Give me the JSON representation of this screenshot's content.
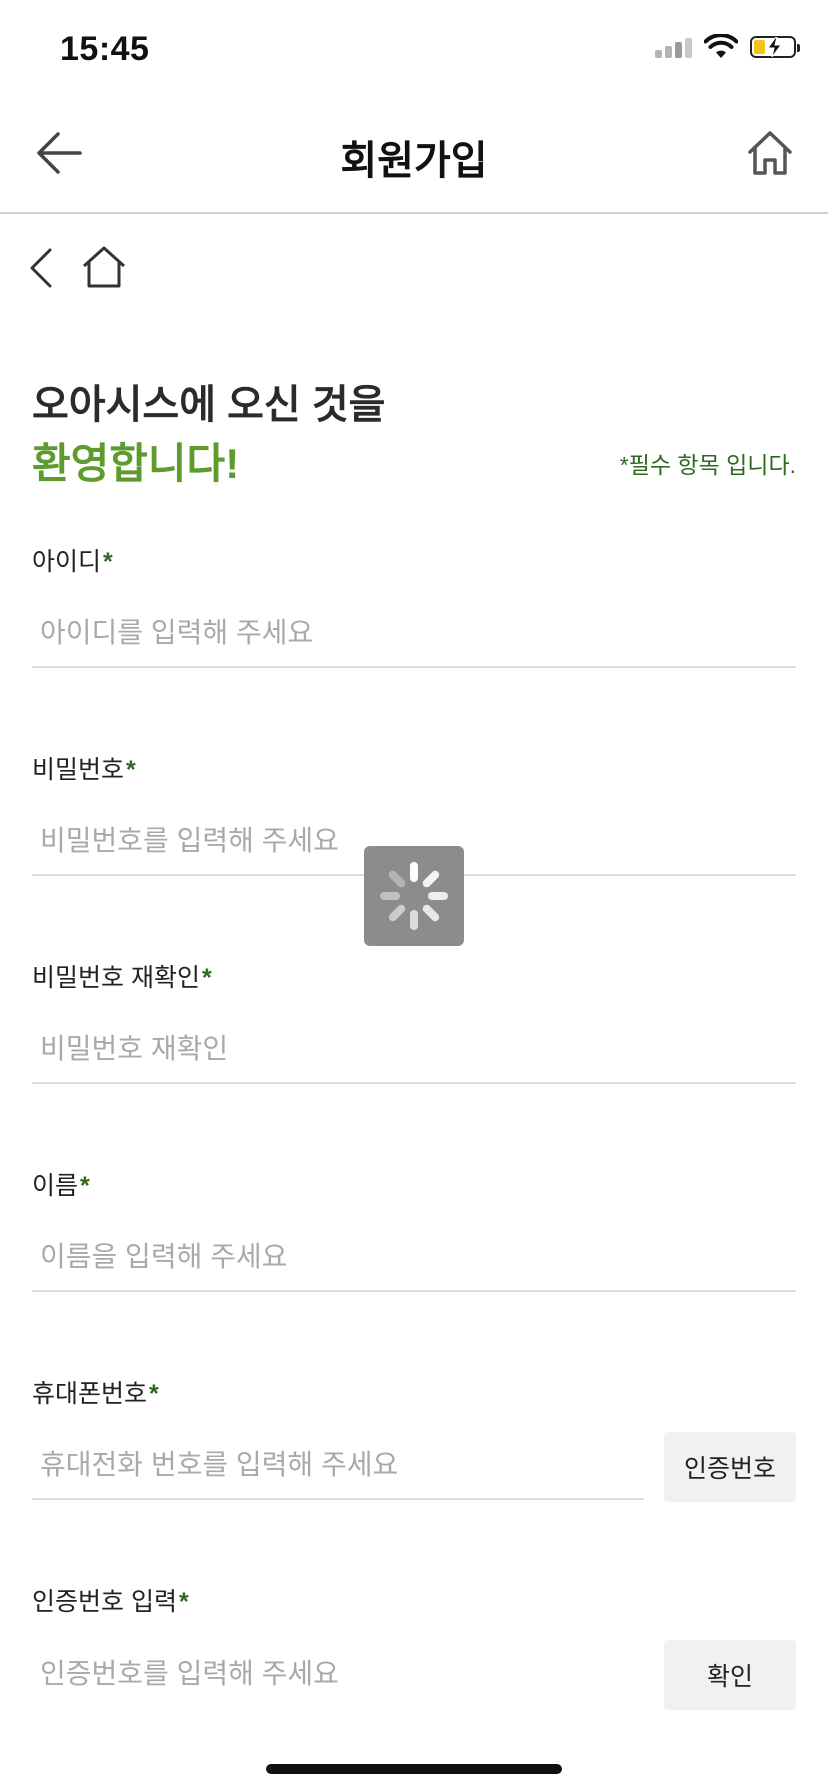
{
  "status_bar": {
    "time": "15:45",
    "icons": [
      "cellular-signal-icon",
      "wifi-icon",
      "battery-charging-icon"
    ],
    "battery_fill_fraction": 0.3,
    "battery_color": "#f2c318"
  },
  "header": {
    "title": "회원가입",
    "back_icon": "arrow-left-icon",
    "home_icon": "home-icon"
  },
  "sub_nav": {
    "back_icon": "chevron-left-icon",
    "home_icon": "home-outline-icon"
  },
  "welcome": {
    "line1": "오아시스에 오신 것을",
    "line2": "환영합니다!",
    "required_note": "*필수 항목 입니다."
  },
  "form": {
    "required_mark": "*",
    "id": {
      "label": "아이디",
      "placeholder": "아이디를 입력해 주세요",
      "value": ""
    },
    "password": {
      "label": "비밀번호",
      "placeholder": "비밀번호를 입력해 주세요",
      "value": ""
    },
    "password_confirm": {
      "label": "비밀번호 재확인",
      "placeholder": "비밀번호 재확인",
      "value": ""
    },
    "name": {
      "label": "이름",
      "placeholder": "이름을 입력해 주세요",
      "value": ""
    },
    "phone": {
      "label": "휴대폰번호",
      "placeholder": "휴대전화 번호를 입력해 주세요",
      "value": "",
      "button_label": "인증번호"
    },
    "verification_code": {
      "label": "인증번호 입력",
      "placeholder": "인증번호를 입력해 주세요",
      "value": "",
      "button_label": "확인"
    }
  },
  "overlay": {
    "loading_icon": "loading-spinner-icon"
  },
  "colors": {
    "brand_green": "#5e9b2e",
    "required_green": "#2c6b1e",
    "placeholder_gray": "#a9a9a9",
    "divider": "#dcdcdc",
    "button_bg": "#f1f1f1"
  }
}
